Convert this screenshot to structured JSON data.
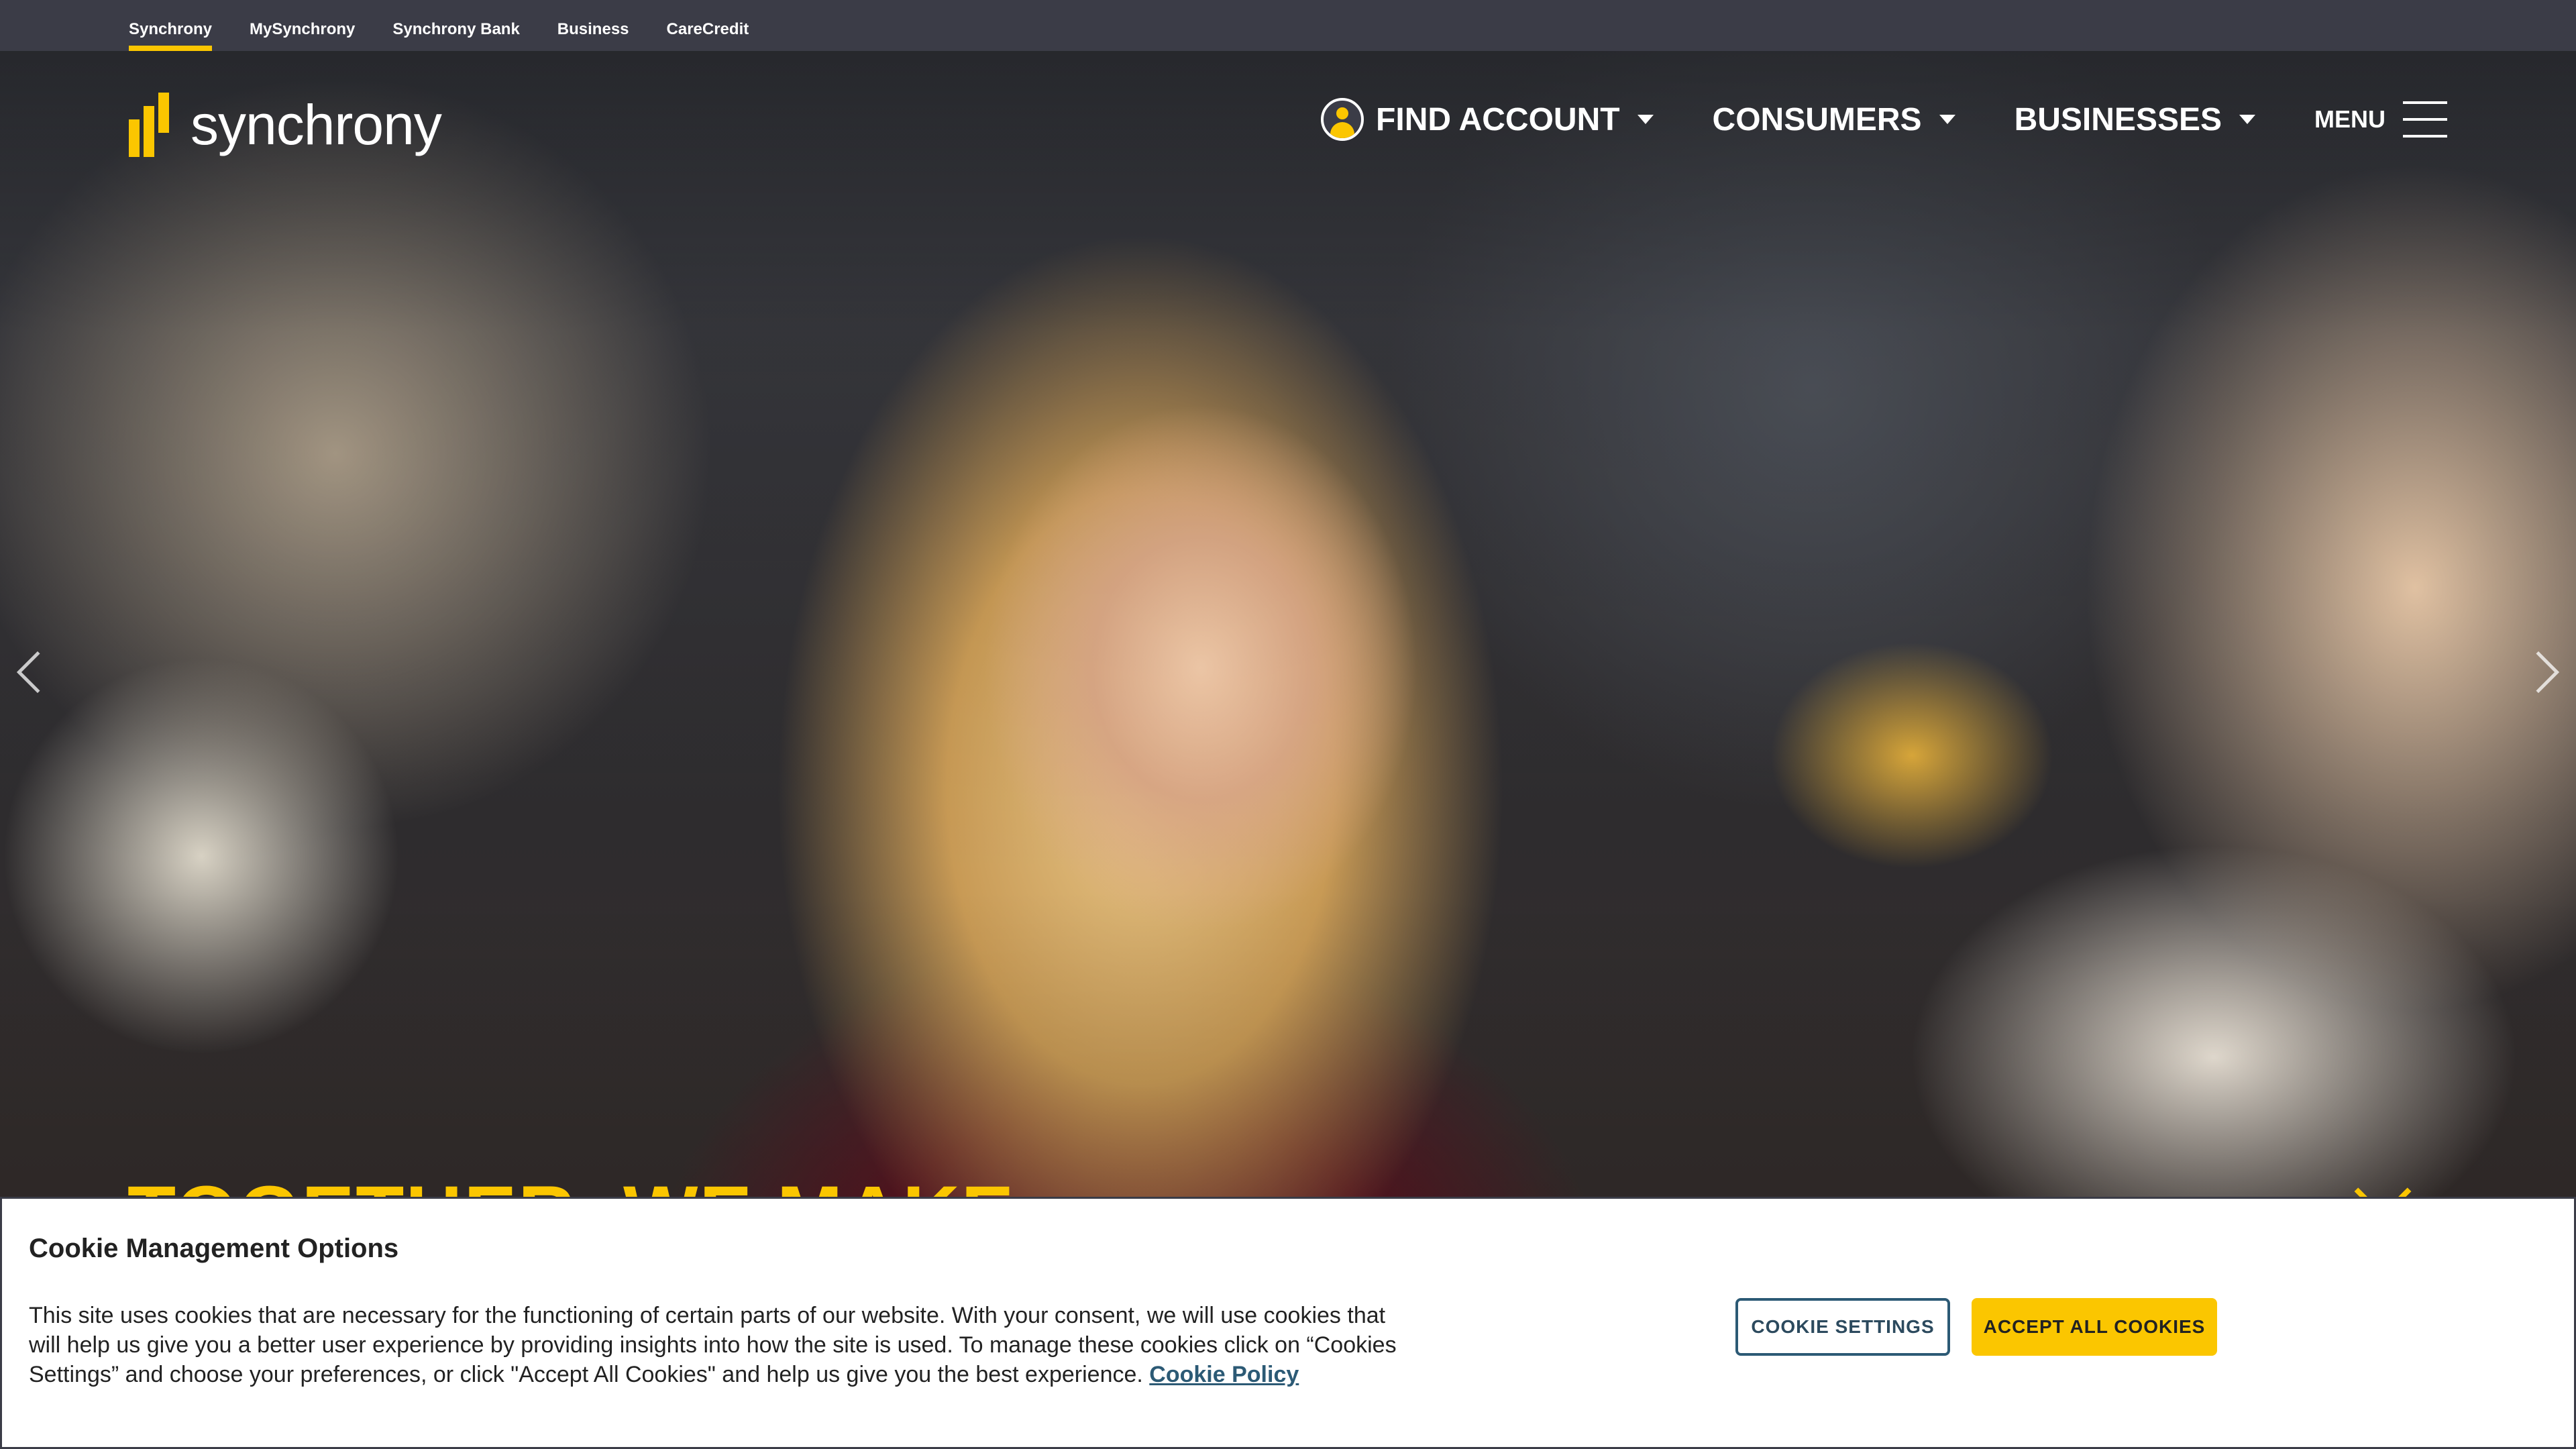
{
  "util_nav": {
    "links": [
      "Synchrony",
      "MySynchrony",
      "Synchrony Bank",
      "Business",
      "CareCredit"
    ]
  },
  "brand": {
    "logo_text": "synchrony",
    "accent_color": "#fbc600",
    "bar_color": "#3b3c47"
  },
  "main_nav": {
    "find_account": "FIND ACCOUNT",
    "consumers": "CONSUMERS",
    "businesses": "BUSINESSES",
    "menu": "MENU"
  },
  "hero": {
    "headline": "TOGETHER, WE MAKE"
  },
  "cookie_banner": {
    "title": "Cookie Management Options",
    "body": "This site uses cookies that are necessary for the functioning of certain parts of our website. With your consent, we will use cookies that will help us give you a better user experience by providing insights into how the site is used. To manage these cookies click on “Cookies Settings” and choose your preferences, or click \"Accept All Cookies\" and help us give you the best experience.",
    "policy_link": "Cookie Policy",
    "settings_button": "COOKIE SETTINGS",
    "accept_button": "ACCEPT ALL COOKIES"
  }
}
